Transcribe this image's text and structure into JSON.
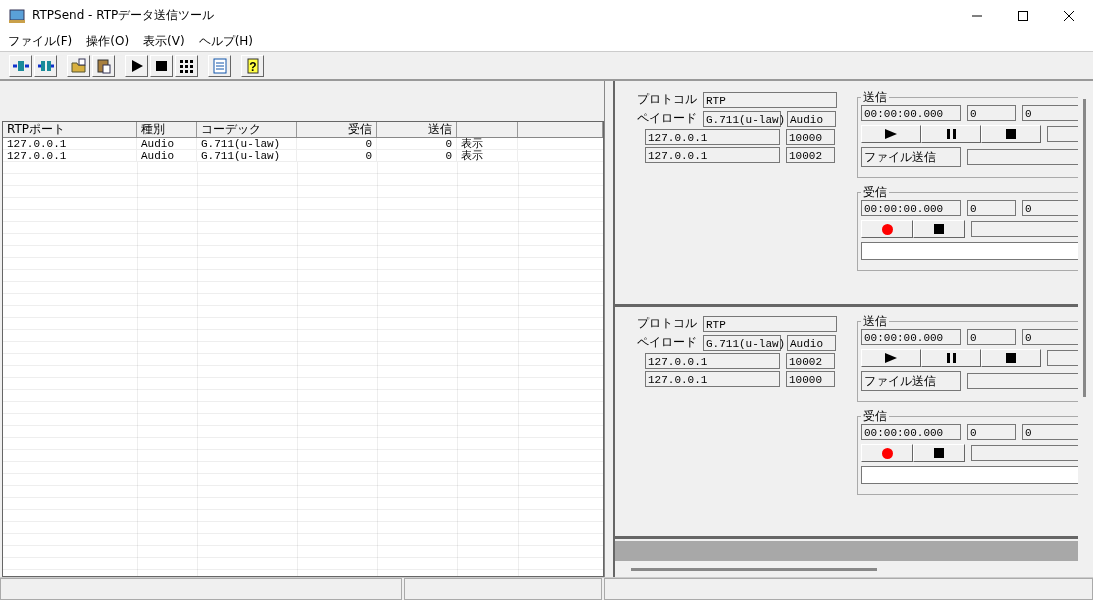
{
  "window": {
    "title": "RTPSend - RTPデータ送信ツール"
  },
  "toolbar": {
    "help_glyph": "?"
  },
  "menu": [
    "ファイル(F)",
    "操作(O)",
    "表示(V)",
    "ヘルプ(H)"
  ],
  "table": {
    "columns": [
      "RTPポート",
      "種別",
      "コーデック",
      "受信",
      "送信"
    ],
    "rows": [
      {
        "port": "127.0.0.1",
        "type": "Audio",
        "codec": "G.711(u-law)",
        "received": "0",
        "sent": "0",
        "column_6": "表示"
      },
      {
        "port": "127.0.0.1",
        "type": "Audio",
        "codec": "G.711(u-law)",
        "received": "0",
        "sent": "0",
        "column_6": "表示"
      }
    ]
  },
  "channels": [
    {
      "protocol_label": "プロトコル",
      "protocol": "RTP",
      "payload_label": "ペイロード",
      "payload": "G.711(u-law)",
      "media": "Audio",
      "addresses": [
        {
          "address": "127.0.0.1",
          "port": "10000"
        },
        {
          "address": "127.0.0.1",
          "port": "10002"
        }
      ],
      "send": {
        "title": "送信",
        "time": "00:00:00.000",
        "count_1": "0",
        "count_2": "0",
        "file_button": "ファイル送信"
      },
      "receive": {
        "title": "受信",
        "time": "00:00:00.000",
        "count_1": "0",
        "count_2": "0"
      }
    },
    {
      "protocol_label": "プロトコル",
      "protocol": "RTP",
      "payload_label": "ペイロード",
      "payload": "G.711(u-law)",
      "media": "Audio",
      "addresses": [
        {
          "address": "127.0.0.1",
          "port": "10002"
        },
        {
          "address": "127.0.0.1",
          "port": "10000"
        }
      ],
      "send": {
        "title": "送信",
        "time": "00:00:00.000",
        "count_1": "0",
        "count_2": "0",
        "file_button": "ファイル送信"
      },
      "receive": {
        "title": "受信",
        "time": "00:00:00.000",
        "count_1": "0",
        "count_2": "0"
      }
    }
  ]
}
